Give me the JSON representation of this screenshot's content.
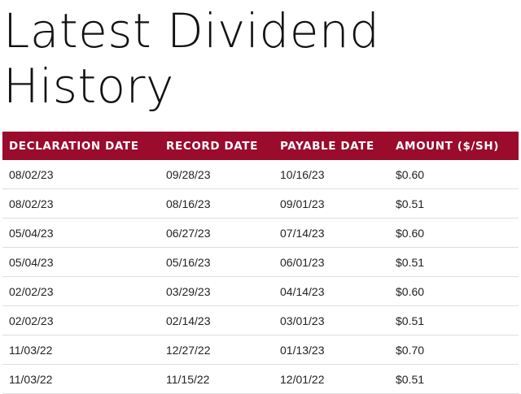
{
  "page": {
    "title_line1": "Latest Dividend",
    "title_line2": "History"
  },
  "table": {
    "headers": [
      "DECLARATION DATE",
      "RECORD DATE",
      "PAYABLE DATE",
      "AMOUNT ($/SH)"
    ],
    "rows": [
      [
        "08/02/23",
        "09/28/23",
        "10/16/23",
        "$0.60"
      ],
      [
        "08/02/23",
        "08/16/23",
        "09/01/23",
        "$0.51"
      ],
      [
        "05/04/23",
        "06/27/23",
        "07/14/23",
        "$0.60"
      ],
      [
        "05/04/23",
        "05/16/23",
        "06/01/23",
        "$0.51"
      ],
      [
        "02/02/23",
        "03/29/23",
        "04/14/23",
        "$0.60"
      ],
      [
        "02/02/23",
        "02/14/23",
        "03/01/23",
        "$0.51"
      ],
      [
        "11/03/22",
        "12/27/22",
        "01/13/23",
        "$0.70"
      ],
      [
        "11/03/22",
        "11/15/22",
        "12/01/22",
        "$0.51"
      ]
    ]
  },
  "colors": {
    "header_bg": "#9a0b2c",
    "header_text": "#ffffff",
    "row_divider": "#dedede"
  }
}
